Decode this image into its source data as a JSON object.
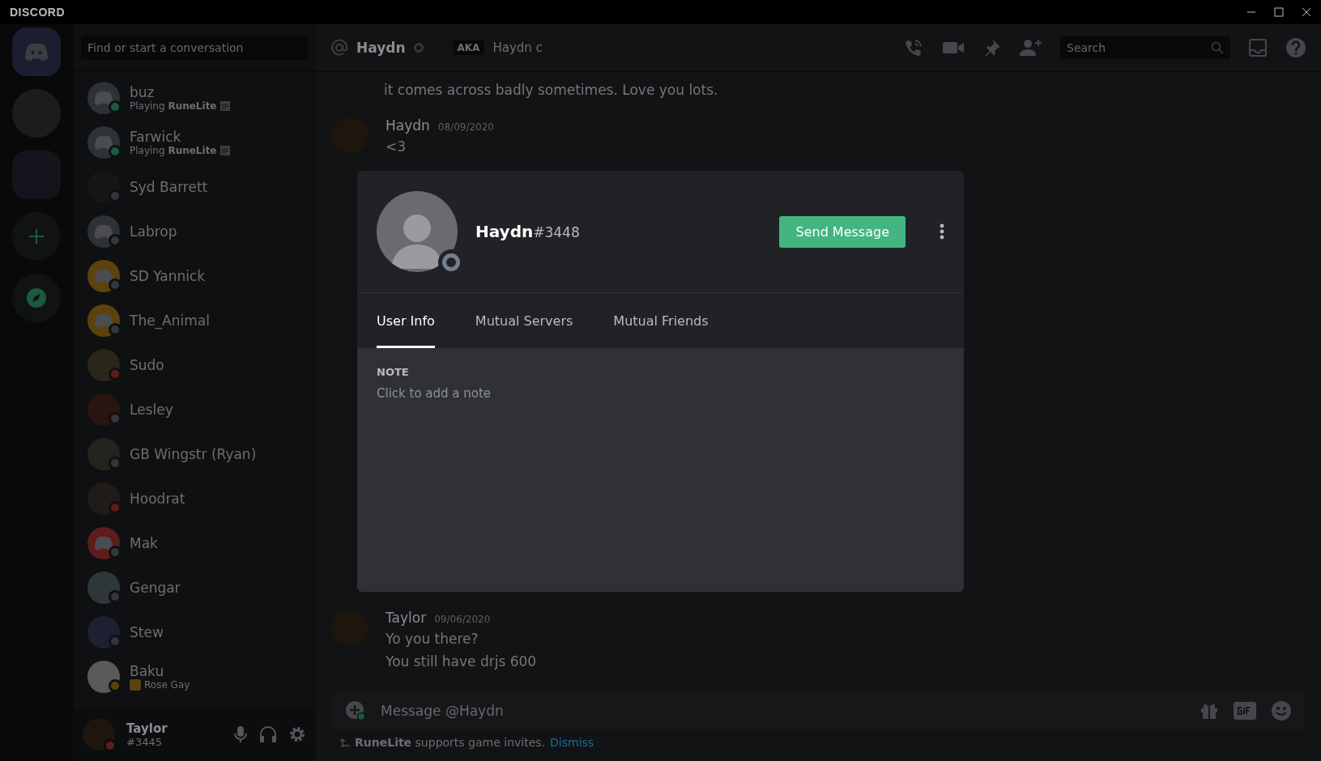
{
  "title_bar": {
    "logo": "DISCORD"
  },
  "servers": [
    {
      "kind": "home",
      "selected": true
    },
    {
      "kind": "photo",
      "selected": false
    },
    {
      "kind": "folder",
      "selected": false
    },
    {
      "kind": "add",
      "selected": false
    },
    {
      "kind": "explore",
      "selected": false
    }
  ],
  "search": {
    "placeholder": "Find or start a conversation"
  },
  "friends": [
    {
      "name": "buz",
      "activity": {
        "kind": "game",
        "text": "Playing **RuneLite**"
      },
      "color": "#1d5a3d",
      "avatar": {
        "kind": "default",
        "color": "#2e3136"
      }
    },
    {
      "name": "Farwick",
      "activity": {
        "kind": "game",
        "text": "Playing **RuneLite**"
      },
      "color": "#1d5a3d",
      "avatar": {
        "kind": "default",
        "color": "#2e3136"
      }
    },
    {
      "name": "Syd Barrett",
      "color": "#33363b",
      "avatar": {
        "kind": "photo",
        "color": "#161616"
      }
    },
    {
      "name": "Labrop",
      "color": "#33363b",
      "avatar": {
        "kind": "default",
        "color": "#2e3136"
      }
    },
    {
      "name": "SD Yannick",
      "color": "#33363b",
      "avatar": {
        "kind": "default",
        "color": "#5e420c"
      }
    },
    {
      "name": "The_Animal",
      "color": "#33363b",
      "avatar": {
        "kind": "default",
        "color": "#5e420c"
      }
    },
    {
      "name": "Sudo",
      "color": "#5e1c1c",
      "avatar": {
        "kind": "photo",
        "color": "#2a261a"
      }
    },
    {
      "name": "Lesley",
      "color": "#33363b",
      "avatar": {
        "kind": "photo",
        "color": "#2a1410"
      }
    },
    {
      "name": "GB Wingstr (Ryan)",
      "color": "#33363b",
      "avatar": {
        "kind": "photo",
        "color": "#24241e"
      }
    },
    {
      "name": "Hoodrat",
      "color": "#5e1c1c",
      "avatar": {
        "kind": "photo",
        "color": "#1e1b18"
      }
    },
    {
      "name": "Mak",
      "color": "#33363b",
      "avatar": {
        "kind": "default",
        "color": "#5e1c1c"
      }
    },
    {
      "name": "Gengar",
      "color": "#33363b",
      "avatar": {
        "kind": "photo",
        "color": "#2e3838"
      }
    },
    {
      "name": "Stew",
      "color": "#33363b",
      "avatar": {
        "kind": "photo",
        "color": "#1c2030"
      }
    },
    {
      "name": "Baku",
      "activity": {
        "kind": "custom",
        "text": "Rose Gay"
      },
      "color": "#5e420c",
      "avatar": {
        "kind": "photo",
        "color": "#5a5a5a"
      }
    }
  ],
  "user_panel": {
    "name": "Taylor",
    "tag": "#3445",
    "color": "#5e1c1c"
  },
  "header": {
    "name": "Haydn",
    "color": "#33363b",
    "aka_label": "AKA",
    "aka": "Haydn c",
    "search_placeholder": "Search"
  },
  "messages": [
    {
      "text": "it comes across badly sometimes. Love you lots."
    },
    {
      "author": "Haydn",
      "date": "08/09/2020",
      "lines": [
        "<3"
      ]
    },
    {
      "author": "Taylor",
      "date": "09/06/2020",
      "lines": [
        "Yo you there?",
        "You still have drjs 600"
      ]
    }
  ],
  "composer": {
    "placeholder": "Message @Haydn",
    "notice": "**RuneLite** supports game invites.",
    "dismiss": "Dismiss"
  },
  "profile": {
    "name": "Haydn",
    "tag": "#3448",
    "color": "#747f8d",
    "button": "Send Message",
    "tabs": [
      {
        "label": "User Info",
        "selected": true
      },
      {
        "label": "Mutual Servers",
        "selected": false
      },
      {
        "label": "Mutual Friends",
        "selected": false
      }
    ],
    "note_label": "NOTE",
    "note_placeholder": "Click to add a note"
  }
}
